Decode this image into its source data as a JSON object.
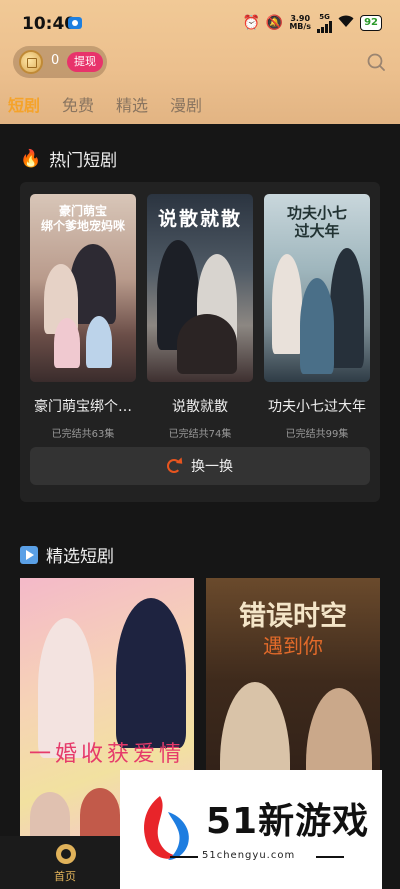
{
  "status_bar": {
    "time": "10:40",
    "net_speed": "3.90",
    "net_unit": "MB/s",
    "network": "5G",
    "battery": "92"
  },
  "header": {
    "coin_count": "0",
    "withdraw_label": "提现",
    "tabs": [
      {
        "label": "短剧",
        "active": true
      },
      {
        "label": "免费",
        "active": false
      },
      {
        "label": "精选",
        "active": false
      },
      {
        "label": "漫剧",
        "active": false
      }
    ]
  },
  "hot": {
    "title": "热门短剧",
    "items": [
      {
        "title": "豪门萌宝绑个…",
        "subtitle": "已完结共63集",
        "poster_text": "豪门萌宝\n绑个爹地宠妈咪"
      },
      {
        "title": "说散就散",
        "subtitle": "已完结共74集",
        "poster_text": "说散就散"
      },
      {
        "title": "功夫小七过大年",
        "subtitle": "已完结共99集",
        "poster_text": "功夫小七\n过大年"
      }
    ],
    "refresh_label": "换一换"
  },
  "featured": {
    "title": "精选短剧",
    "items": [
      {
        "poster_text": "一婚收获爱情"
      },
      {
        "poster_text_main": "错误时空",
        "poster_text_sub": "遇到你"
      }
    ]
  },
  "watermark": {
    "brand": "51新游戏",
    "url": "51chengyu.com"
  },
  "bottom_nav": {
    "home_label": "首页"
  }
}
